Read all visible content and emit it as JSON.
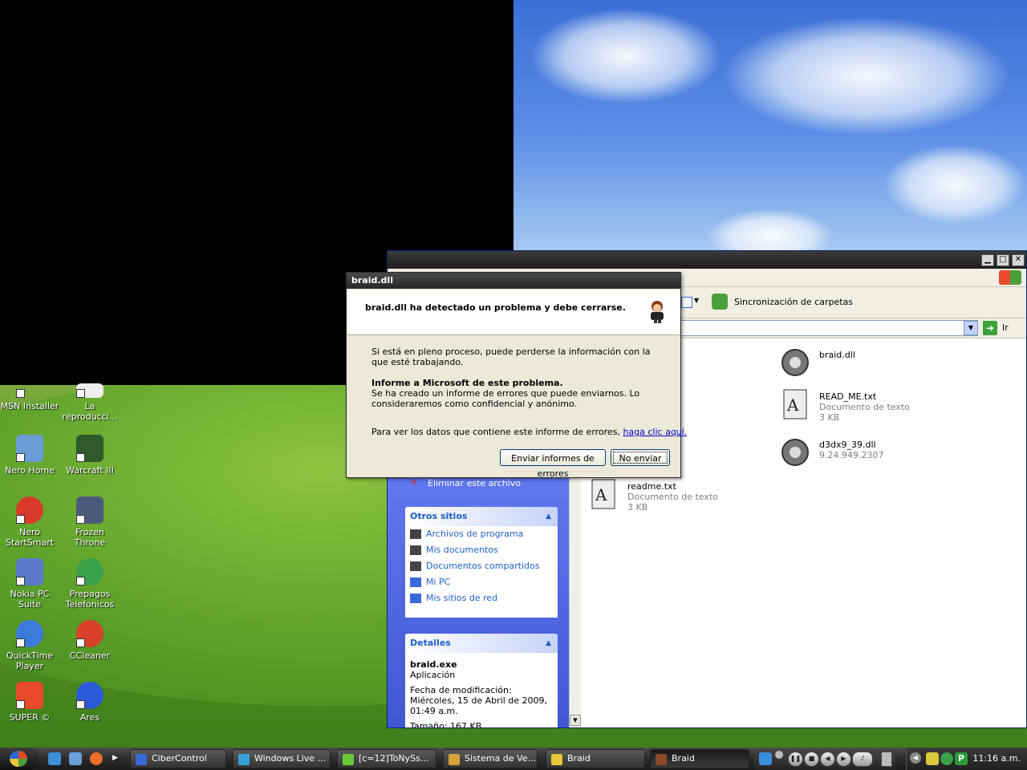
{
  "desktop": {
    "icons": [
      {
        "label": "MSN Installer",
        "color": "#3a8fd8"
      },
      {
        "label": "La reproducci...",
        "color": "#e8e8e8"
      },
      {
        "label": "Nero Home",
        "color": "#6b9ed8"
      },
      {
        "label": "Warcraft III",
        "color": "#2f5a2a"
      },
      {
        "label": "Nero StartSmart",
        "color": "#d93a2a"
      },
      {
        "label": "Frozen Throne",
        "color": "#4a5a7a"
      },
      {
        "label": "Nokia PC Suite",
        "color": "#5a7ac8"
      },
      {
        "label": "Prepagos Telefonicos",
        "color": "#3aa04a"
      },
      {
        "label": "QuickTime Player",
        "color": "#3a7ad8"
      },
      {
        "label": "CCleaner",
        "color": "#d8402a"
      },
      {
        "label": "SUPER ©",
        "color": "#e84a2a"
      },
      {
        "label": "Ares",
        "color": "#2a5ad8"
      }
    ]
  },
  "explorer": {
    "toolbar": {
      "sync_label": "Sincronización de carpetas"
    },
    "address": {
      "go_label": "Ir"
    },
    "sidebar": {
      "hidden_task": "Eliminar este archivo",
      "other_places": {
        "title": "Otros sitios",
        "items": [
          "Archivos de programa",
          "Mis documentos",
          "Documentos compartidos",
          "Mi PC",
          "Mis sitios de red"
        ]
      },
      "details": {
        "title": "Detalles",
        "name": "braid.exe",
        "type": "Aplicación",
        "modified": "Fecha de modificación: Miércoles, 15 de Abril de 2009, 01:49 a.m.",
        "size": "Tamaño: 167 KB"
      }
    },
    "files": [
      {
        "name": "braid.dll",
        "sub1": "",
        "sub2": "",
        "kind": "dll"
      },
      {
        "name": "READ_ME.txt",
        "sub1": "Documento de texto",
        "sub2": "3 KB",
        "kind": "txt"
      },
      {
        "name": "d3dx9_39.dll",
        "sub1": "9.24.949.2307",
        "sub2": "",
        "kind": "dll"
      },
      {
        "name": "readme.txt",
        "sub1": "Documento de texto",
        "sub2": "3 KB",
        "kind": "txt"
      }
    ]
  },
  "dialog": {
    "title": "braid.dll",
    "heading": "braid.dll ha detectado un problema y debe cerrarse.",
    "para1": "Si está en pleno proceso, puede perderse la información con la que esté trabajando.",
    "report_title": "Informe a Microsoft de este problema.",
    "para2": "Se ha creado un informe de errores que puede enviarnos. Lo consideraremos como confidencial y anónimo.",
    "para3": "Para ver los datos que contiene este informe de errores,",
    "link": "haga clic aquí.",
    "send_button": "Enviar informes de errores",
    "dont_send_button": "No enviar"
  },
  "taskbar": {
    "buttons": [
      {
        "label": "CiberControl",
        "color": "#3a6ad8"
      },
      {
        "label": "Windows Live ...",
        "color": "#3aa0d8"
      },
      {
        "label": "[c=12]ToNySs...",
        "color": "#6ac83a"
      },
      {
        "label": "Sistema de Ve...",
        "color": "#d8a03a"
      },
      {
        "label": "Braid",
        "color": "#e8c83a"
      },
      {
        "label": "Braid",
        "color": "#8a4a2a"
      }
    ],
    "clock": "11:16 a.m."
  }
}
